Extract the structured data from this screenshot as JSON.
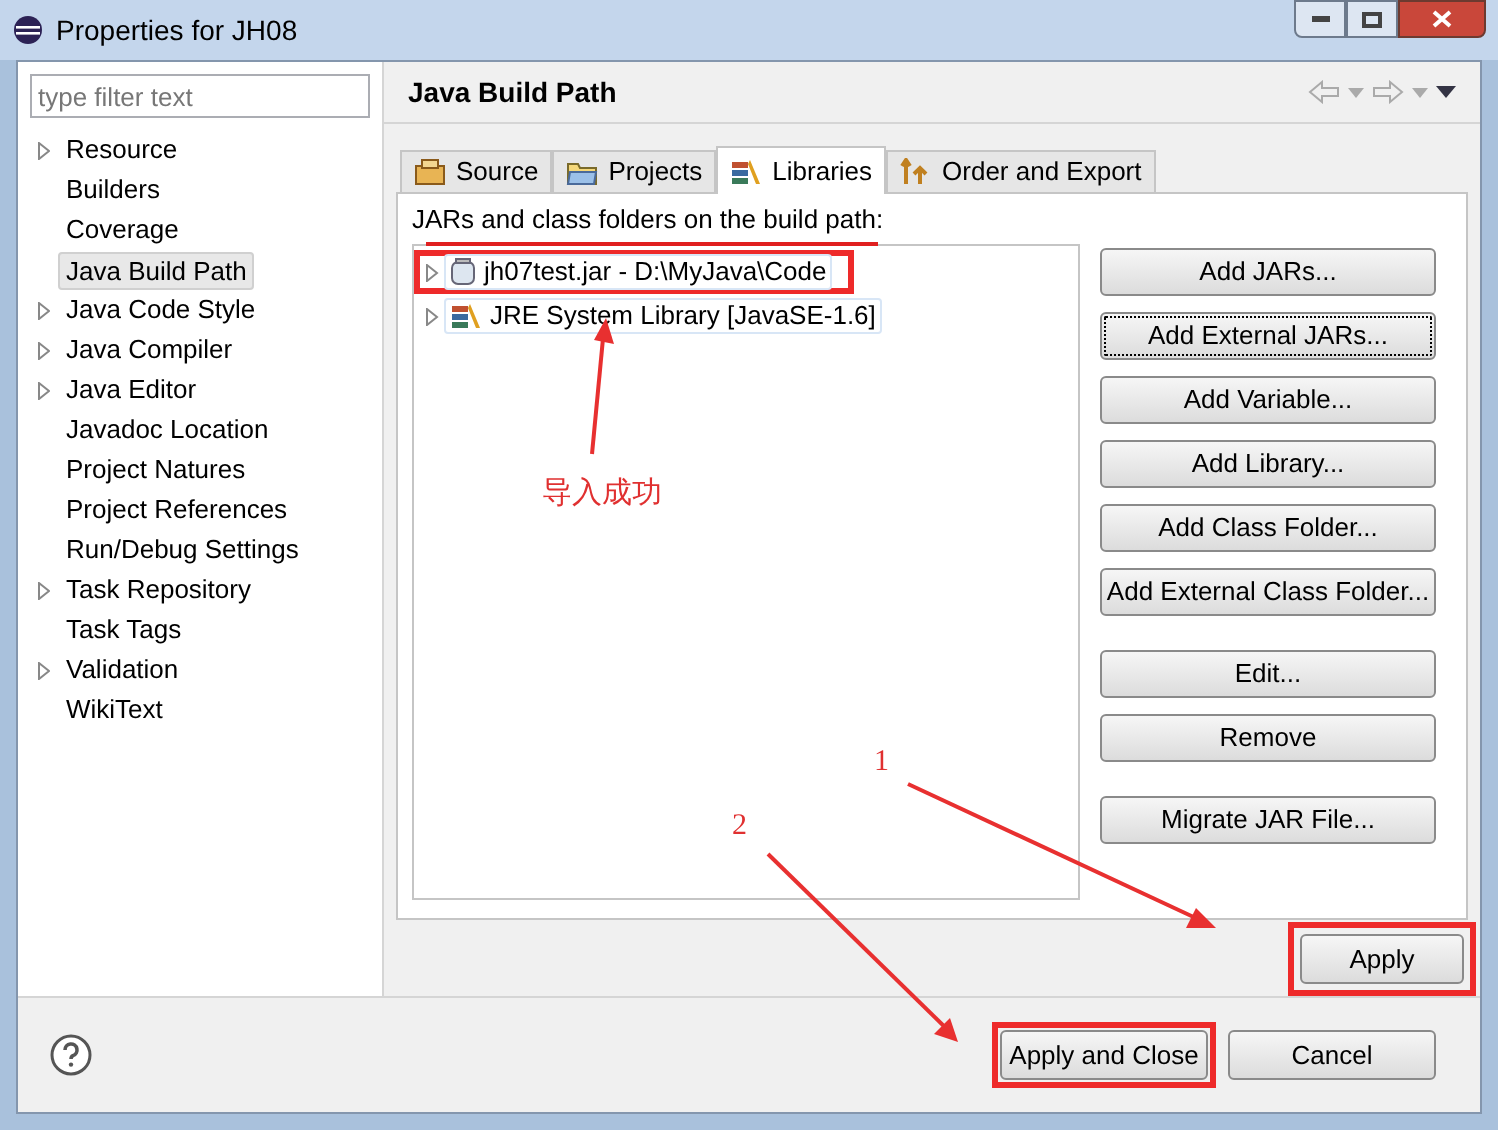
{
  "window": {
    "title": "Properties for JH08"
  },
  "filter": {
    "placeholder": "type filter text"
  },
  "nav": [
    {
      "label": "Resource",
      "expandable": true,
      "selected": false
    },
    {
      "label": "Builders",
      "expandable": false,
      "selected": false
    },
    {
      "label": "Coverage",
      "expandable": false,
      "selected": false
    },
    {
      "label": "Java Build Path",
      "expandable": false,
      "selected": true
    },
    {
      "label": "Java Code Style",
      "expandable": true,
      "selected": false
    },
    {
      "label": "Java Compiler",
      "expandable": true,
      "selected": false
    },
    {
      "label": "Java Editor",
      "expandable": true,
      "selected": false
    },
    {
      "label": "Javadoc Location",
      "expandable": false,
      "selected": false
    },
    {
      "label": "Project Natures",
      "expandable": false,
      "selected": false
    },
    {
      "label": "Project References",
      "expandable": false,
      "selected": false
    },
    {
      "label": "Run/Debug Settings",
      "expandable": false,
      "selected": false
    },
    {
      "label": "Task Repository",
      "expandable": true,
      "selected": false
    },
    {
      "label": "Task Tags",
      "expandable": false,
      "selected": false
    },
    {
      "label": "Validation",
      "expandable": true,
      "selected": false
    },
    {
      "label": "WikiText",
      "expandable": false,
      "selected": false
    }
  ],
  "page_title": "Java Build Path",
  "tabs": [
    {
      "label": "Source",
      "kind": "source",
      "selected": false
    },
    {
      "label": "Projects",
      "kind": "projects",
      "selected": false
    },
    {
      "label": "Libraries",
      "kind": "libraries",
      "selected": true
    },
    {
      "label": "Order and Export",
      "kind": "order",
      "selected": false
    }
  ],
  "list_label": "JARs and class folders on the build path:",
  "entries": [
    {
      "label": "jh07test.jar - D:\\MyJava\\Code",
      "kind": "jar",
      "highlighted": true
    },
    {
      "label": "JRE System Library [JavaSE-1.6]",
      "kind": "library",
      "highlighted": false
    }
  ],
  "side_buttons": [
    {
      "label": "Add JARs...",
      "focused": false
    },
    {
      "label": "Add External JARs...",
      "focused": true
    },
    {
      "label": "Add Variable...",
      "focused": false
    },
    {
      "label": "Add Library...",
      "focused": false
    },
    {
      "label": "Add Class Folder...",
      "focused": false
    },
    {
      "label": "Add External Class Folder...",
      "focused": false
    },
    {
      "label": "Edit...",
      "focused": false
    },
    {
      "label": "Remove",
      "focused": false
    },
    {
      "label": "Migrate JAR File...",
      "focused": false
    }
  ],
  "apply": {
    "label": "Apply",
    "highlighted": true
  },
  "footer_buttons": [
    {
      "label": "Apply and Close",
      "highlighted": true
    },
    {
      "label": "Cancel",
      "highlighted": false
    }
  ],
  "annotations": [
    {
      "text": "导入成功"
    },
    {
      "text": "1"
    },
    {
      "text": "2"
    }
  ]
}
